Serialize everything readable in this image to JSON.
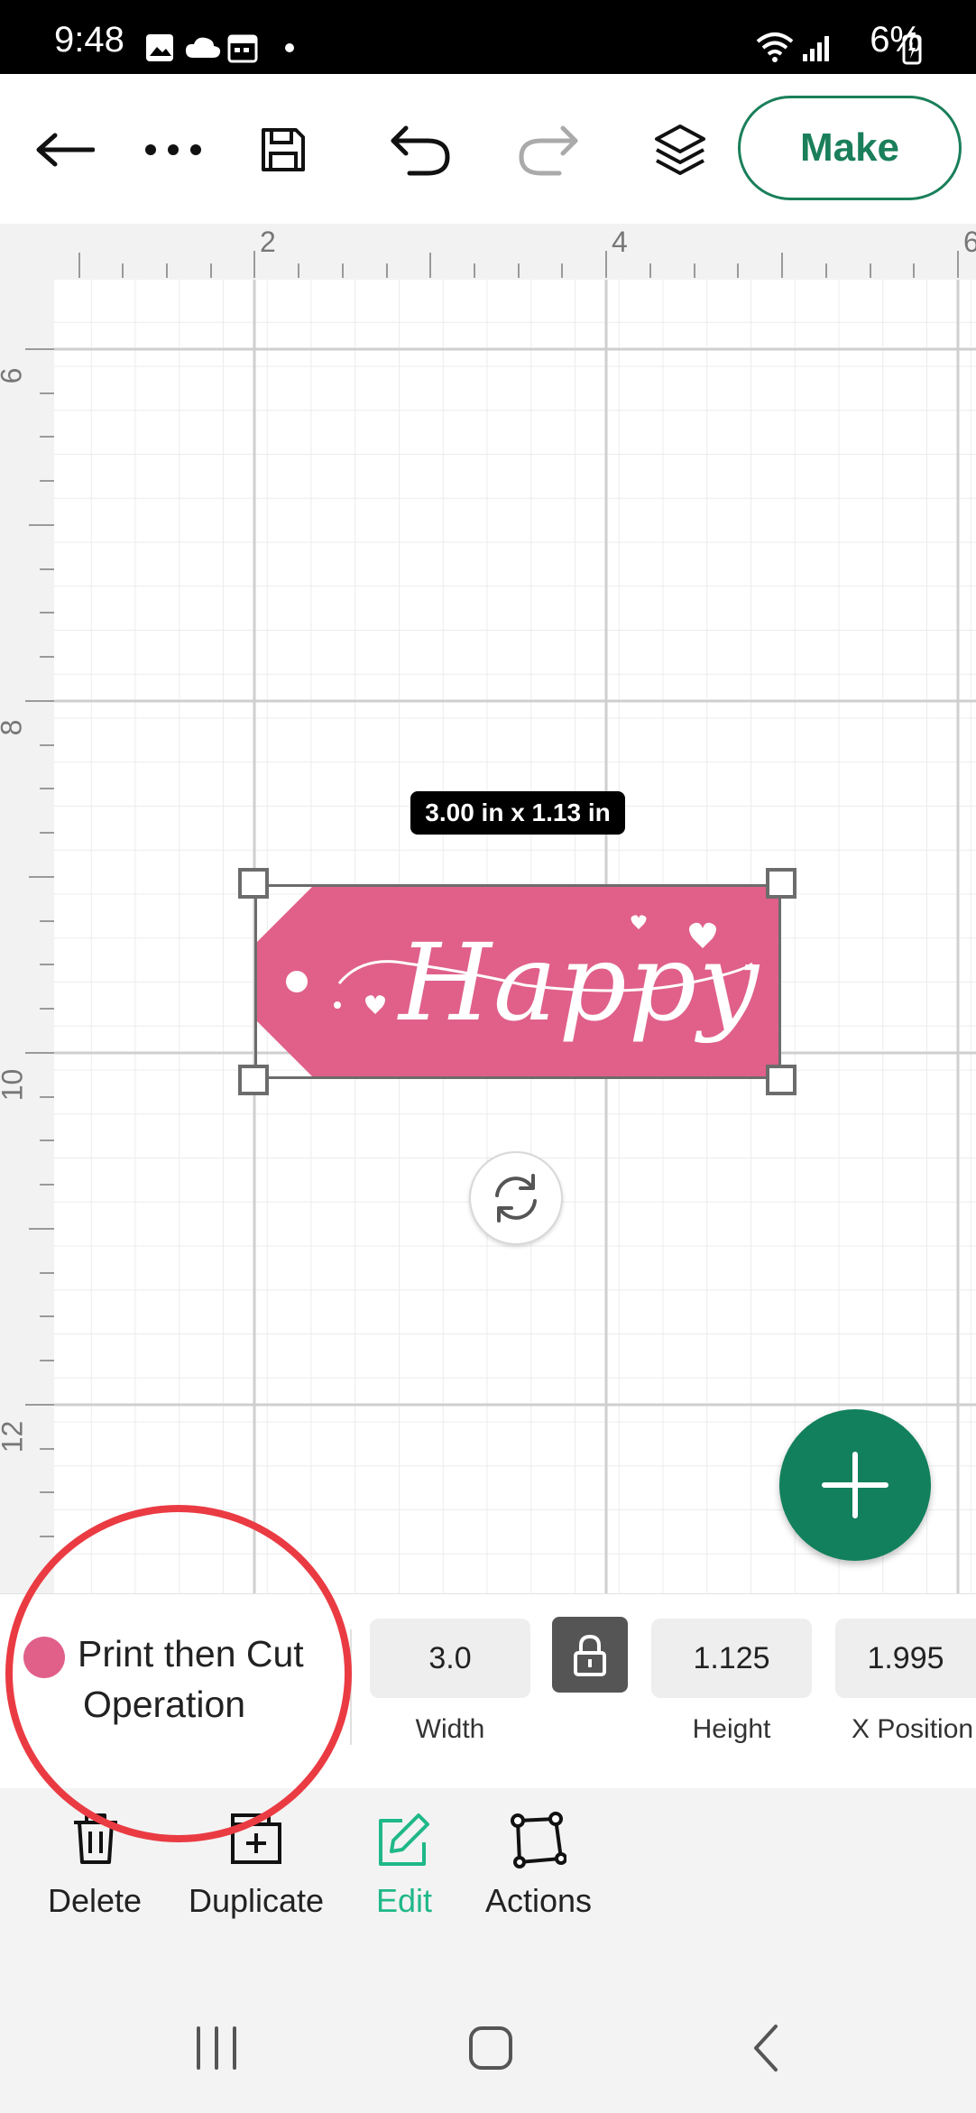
{
  "status_bar": {
    "time": "9:48",
    "battery": "6%"
  },
  "toolbar": {
    "make_label": "Make"
  },
  "rulers": {
    "top": [
      "2",
      "4",
      "6"
    ],
    "left": [
      "6",
      "8",
      "10",
      "12"
    ]
  },
  "canvas": {
    "dimension_badge": "3.00 in x 1.13 in",
    "object_text": "Happy"
  },
  "properties": {
    "operation_label_line1": "Print then Cut",
    "operation_label_line2": "Operation",
    "operation_color": "#e0608a",
    "width_value": "3.0",
    "width_label": "Width",
    "height_value": "1.125",
    "height_label": "Height",
    "xpos_value": "1.995",
    "xpos_label": "X Position"
  },
  "actions": {
    "delete_label": "Delete",
    "duplicate_label": "Duplicate",
    "edit_label": "Edit",
    "actions_label": "Actions"
  },
  "colors": {
    "brand_green": "#1a7f5a",
    "tag_pink": "#e0608a",
    "annotation_red": "#ea3b43"
  }
}
